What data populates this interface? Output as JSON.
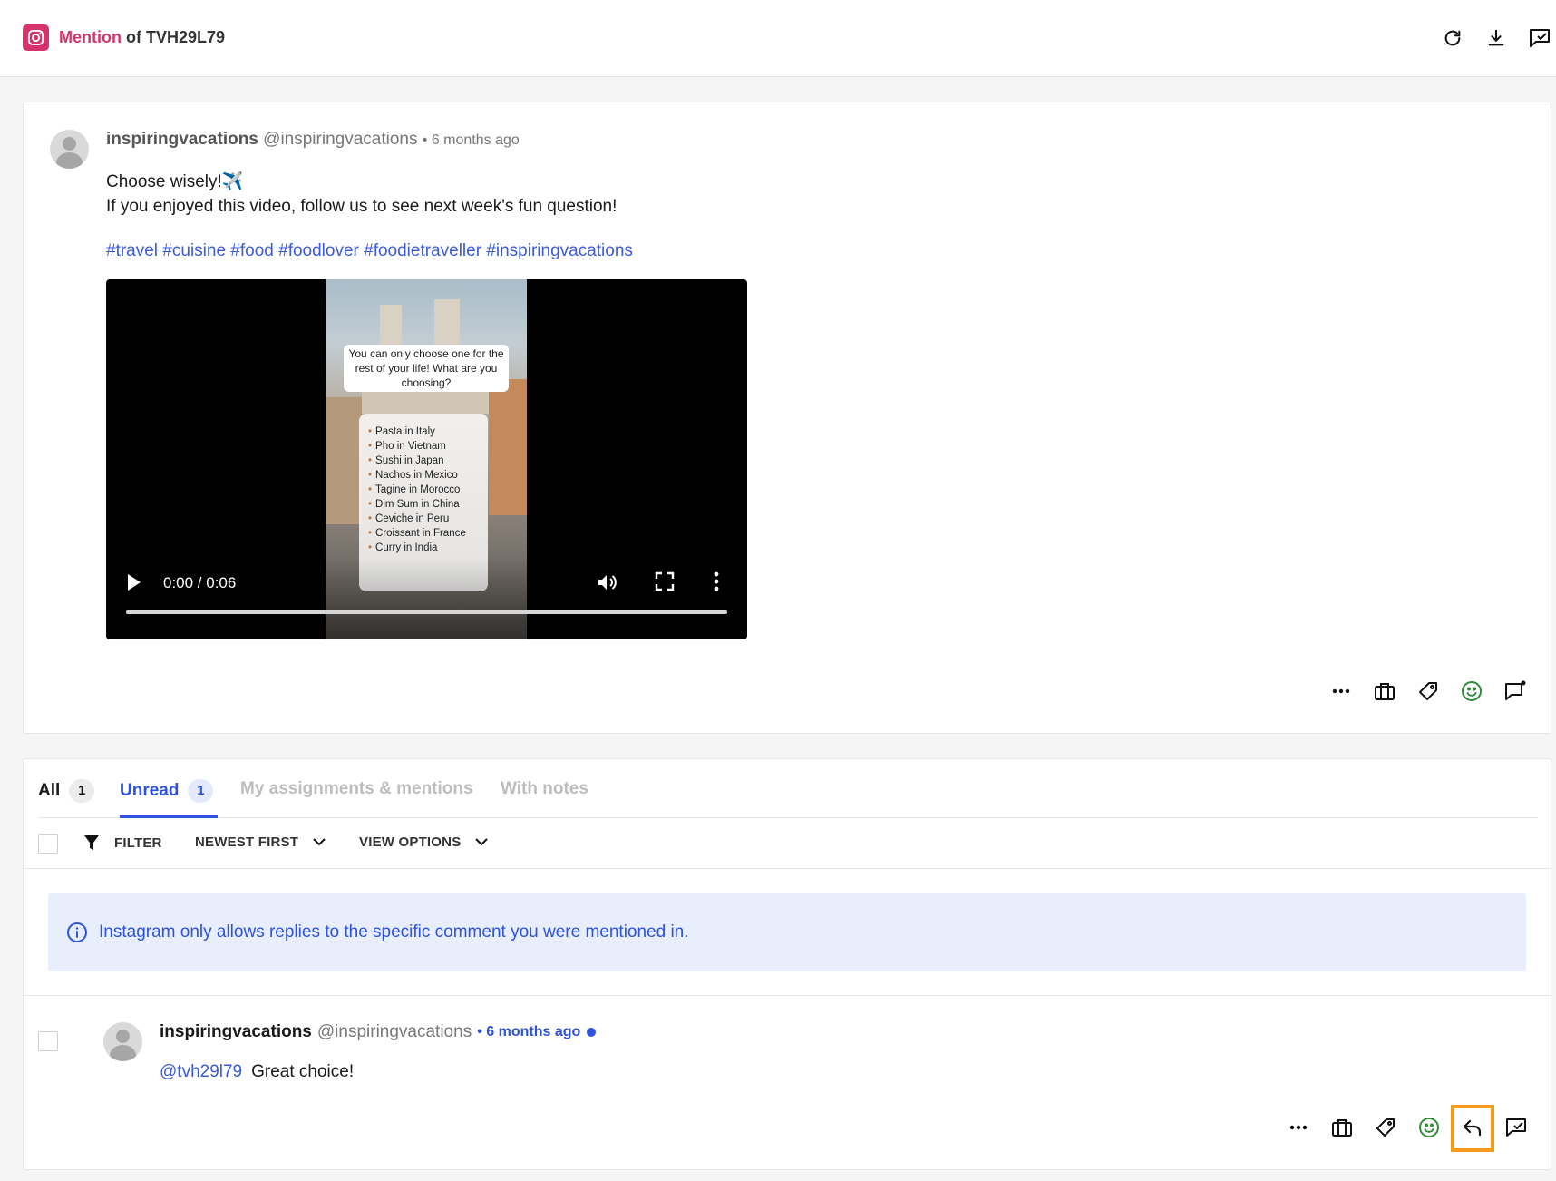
{
  "header": {
    "type_label": "Mention",
    "of_label": "of TVH29L79",
    "icons": [
      "instagram-icon",
      "refresh-icon",
      "download-icon",
      "mark-done-icon"
    ]
  },
  "post": {
    "author_name": "inspiringvacations",
    "author_handle": "@inspiringvacations",
    "time": "• 6 months ago",
    "text_line1": "Choose wisely!✈️",
    "text_line2": "If you enjoyed this video, follow us to see next week's fun question!",
    "hashtags": "#travel #cuisine #food #foodlover #foodietraveller #inspiringvacations",
    "video": {
      "time_display": "0:00 / 0:06",
      "frame_question": "You can only choose one for the rest of your life! What are you choosing?",
      "frame_items": [
        "Pasta in Italy",
        "Pho in Vietnam",
        "Sushi in Japan",
        "Nachos in Mexico",
        "Tagine in Morocco",
        "Dim Sum in China",
        "Ceviche in Peru",
        "Croissant in France",
        "Curry in India"
      ],
      "progress": 0
    },
    "actions": [
      "more-icon",
      "briefcase-icon",
      "tag-icon",
      "smiley-icon",
      "note-icon"
    ]
  },
  "tabs": {
    "all_label": "All",
    "all_count": "1",
    "unread_label": "Unread",
    "unread_count": "1",
    "assignments_label": "My assignments & mentions",
    "notes_label": "With notes",
    "active": "Unread"
  },
  "toolbar": {
    "filter_label": "FILTER",
    "sort_label": "NEWEST FIRST",
    "view_label": "VIEW OPTIONS"
  },
  "info_banner": {
    "text": "Instagram only allows replies to the specific comment you were mentioned in."
  },
  "comment": {
    "author_name": "inspiringvacations",
    "author_handle": "@inspiringvacations",
    "time": "• 6 months ago",
    "mention": "@tvh29l79",
    "text": "Great choice!",
    "unread": true,
    "actions": [
      "more-icon",
      "briefcase-icon",
      "tag-icon",
      "smiley-icon",
      "reply-icon",
      "mark-done-icon"
    ]
  },
  "colors": {
    "instagram": "#d6336c",
    "accent": "#2d52e0",
    "smiley": "#2e8b3a",
    "highlight": "#f29a1a"
  }
}
